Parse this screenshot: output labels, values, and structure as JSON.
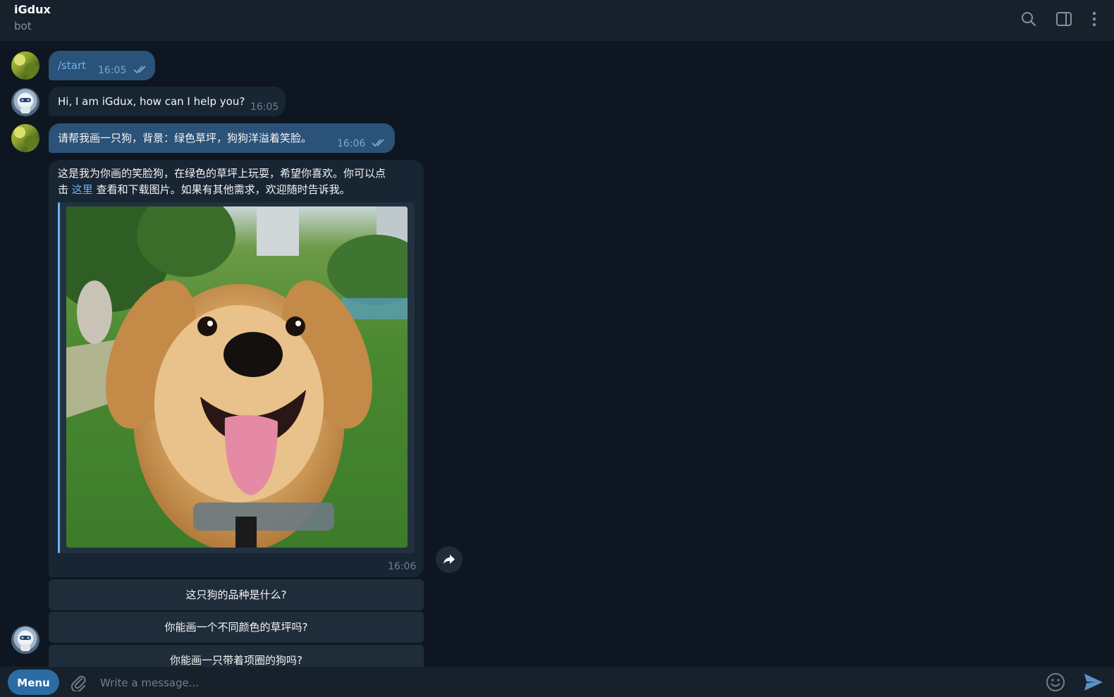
{
  "header": {
    "title": "iGdux",
    "subtitle": "bot",
    "icons": [
      "search-icon",
      "sidebar-toggle-icon",
      "more-vertical-icon"
    ]
  },
  "messages": [
    {
      "sender": "user",
      "text": "/start",
      "time": "16:05",
      "status": "read"
    },
    {
      "sender": "bot",
      "text": "Hi, I am iGdux, how can I help you?",
      "time": "16:05"
    },
    {
      "sender": "user",
      "text": "请帮我画一只狗，背景：绿色草坪，狗狗洋溢着笑脸。",
      "time": "16:06",
      "status": "read"
    },
    {
      "sender": "bot",
      "line1": "这是我为你画的笑脸狗，在绿色的草坪上玩耍，希望你喜欢。你可以点",
      "line2_prefix": "击 ",
      "link_text": "这里",
      "line2_suffix": " 查看和下载图片。如果有其他需求，欢迎随时告诉我。",
      "time": "16:06"
    }
  ],
  "keyboard_buttons": [
    "这只狗的品种是什么?",
    "你能画一个不同颜色的草坪吗?",
    "你能画一只带着项圈的狗吗?"
  ],
  "composer": {
    "menu_label": "Menu",
    "placeholder": "Write a message..."
  },
  "colors": {
    "background": "#0e1621",
    "header": "#17212b",
    "outgoing_bubble": "#2b5278",
    "incoming_bubble": "#182533",
    "accent": "#6ab3f3",
    "menu_button": "#2b6ca3"
  }
}
